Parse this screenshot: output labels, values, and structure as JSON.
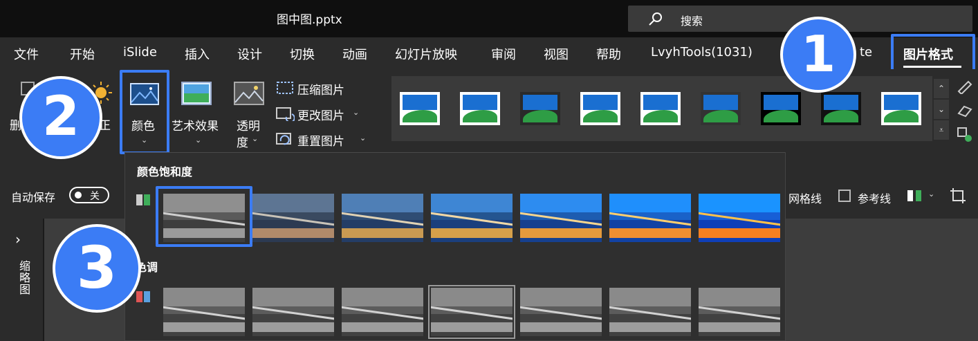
{
  "window": {
    "title": "图中图.pptx"
  },
  "search": {
    "label": "搜索"
  },
  "tabs": [
    {
      "label": "文件"
    },
    {
      "label": "开始"
    },
    {
      "label": "iSlide"
    },
    {
      "label": "插入"
    },
    {
      "label": "设计"
    },
    {
      "label": "切换"
    },
    {
      "label": "动画"
    },
    {
      "label": "幻灯片放映"
    },
    {
      "label": "审阅"
    },
    {
      "label": "视图"
    },
    {
      "label": "帮助"
    },
    {
      "label": "LvyhTools(1031)"
    },
    {
      "label": "te"
    },
    {
      "label": "图片格式"
    }
  ],
  "active_tab": "图片格式",
  "ribbon": {
    "partial_left_a": "删",
    "partial_left_b": "正",
    "color_label": "颜色",
    "artistic_label": "艺术效果",
    "transparency_label_1": "透明",
    "transparency_label_2": "度",
    "compress_label": "压缩图片",
    "change_label": "更改图片",
    "reset_label": "重置图片",
    "picture_styles_count": 9
  },
  "status": {
    "autosave_label": "自动保存",
    "autosave_state": "关",
    "gridlines_label": "网格线",
    "guides_label": "参考线"
  },
  "leftpane": {
    "thumbnails_label": "缩略图",
    "expand_glyph": "›"
  },
  "dropdown": {
    "saturation_header": "颜色饱和度",
    "tone_header": "色调",
    "saturation_thumbs": 7,
    "tone_thumbs": 7,
    "selected_saturation_index": 0,
    "selected_tone_index": 3
  },
  "badges": [
    "1",
    "2",
    "3"
  ],
  "colors": {
    "accent": "#3b7cf5",
    "dark": "#0f0f0f",
    "ribbon": "#2b2b2b"
  }
}
